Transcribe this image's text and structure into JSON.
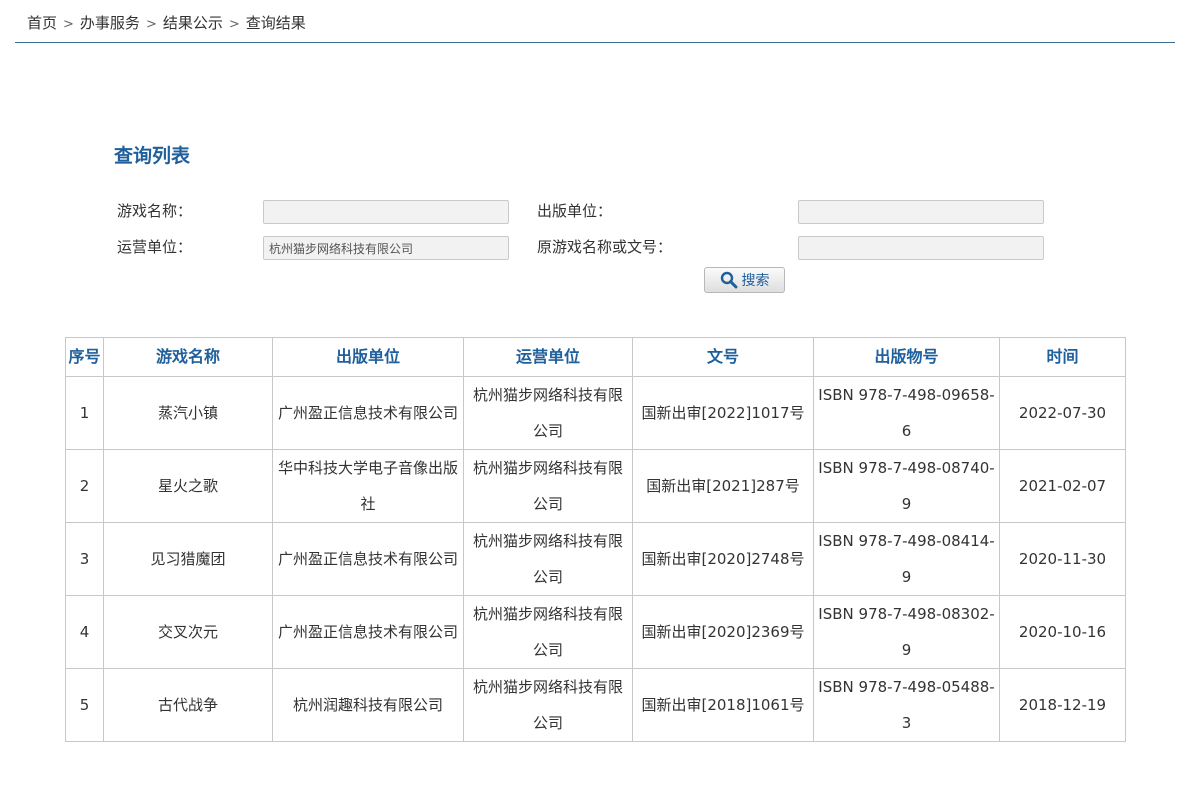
{
  "breadcrumb": {
    "items": [
      "首页",
      "办事服务",
      "结果公示",
      "查询结果"
    ],
    "separator": ">"
  },
  "section_title": "查询列表",
  "form": {
    "game_name": {
      "label": "游戏名称：",
      "value": ""
    },
    "publisher": {
      "label": "出版单位：",
      "value": ""
    },
    "operator": {
      "label": "运营单位：",
      "value": "杭州猫步网络科技有限公司"
    },
    "original_name_or_number": {
      "label": "原游戏名称或文号：",
      "value": ""
    },
    "search_button": {
      "label": "搜索",
      "icon": "magnifier-icon"
    }
  },
  "table": {
    "headers": [
      "序号",
      "游戏名称",
      "出版单位",
      "运营单位",
      "文号",
      "出版物号",
      "时间"
    ],
    "rows": [
      [
        "1",
        "蒸汽小镇",
        "广州盈正信息技术有限公司",
        "杭州猫步网络科技有限公司",
        "国新出审[2022]1017号",
        "ISBN 978-7-498-09658-6",
        "2022-07-30"
      ],
      [
        "2",
        "星火之歌",
        "华中科技大学电子音像出版社",
        "杭州猫步网络科技有限公司",
        "国新出审[2021]287号",
        "ISBN 978-7-498-08740-9",
        "2021-02-07"
      ],
      [
        "3",
        "见习猎魔团",
        "广州盈正信息技术有限公司",
        "杭州猫步网络科技有限公司",
        "国新出审[2020]2748号",
        "ISBN 978-7-498-08414-9",
        "2020-11-30"
      ],
      [
        "4",
        "交叉次元",
        "广州盈正信息技术有限公司",
        "杭州猫步网络科技有限公司",
        "国新出审[2020]2369号",
        "ISBN 978-7-498-08302-9",
        "2020-10-16"
      ],
      [
        "5",
        "古代战争",
        "杭州润趣科技有限公司",
        "杭州猫步网络科技有限公司",
        "国新出审[2018]1061号",
        "ISBN 978-7-498-05488-3",
        "2018-12-19"
      ]
    ]
  },
  "colors": {
    "accent": "#1e5f9c",
    "rule": "#3e6c8f",
    "border": "#c8c8c8",
    "input_bg": "#f2f2f2"
  }
}
